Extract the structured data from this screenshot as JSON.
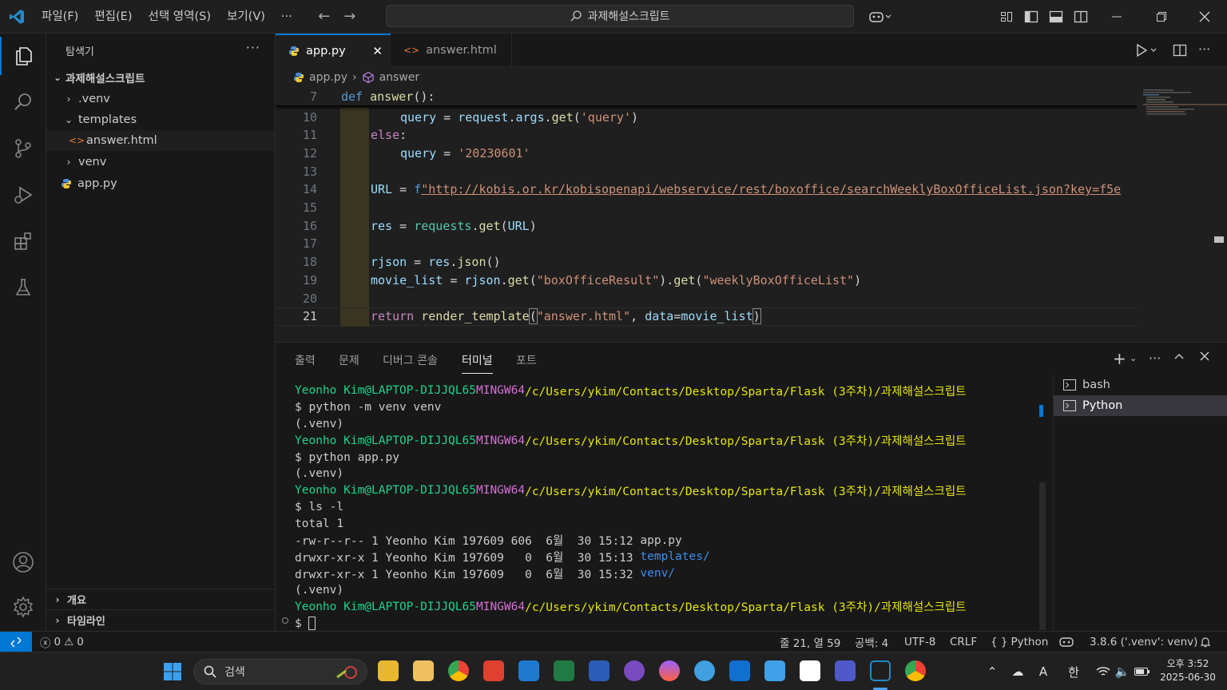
{
  "menu": [
    "파일(F)",
    "편집(E)",
    "선택 영역(S)",
    "보기(V)"
  ],
  "menu_more": "···",
  "command_center": "과제해설스크립트",
  "sidebar": {
    "title": "탐색기",
    "more": "···",
    "root": "과제해설스크립트",
    "items": [
      {
        "label": ".venv",
        "type": "folder-collapsed"
      },
      {
        "label": "templates",
        "type": "folder-expanded"
      },
      {
        "label": "answer.html",
        "type": "html-file"
      },
      {
        "label": "venv",
        "type": "folder-collapsed"
      },
      {
        "label": "app.py",
        "type": "python-file"
      }
    ],
    "outline": "개요",
    "timeline": "타임라인"
  },
  "tabs": [
    {
      "label": "app.py",
      "active": true
    },
    {
      "label": "answer.html",
      "active": false
    }
  ],
  "breadcrumb": {
    "file": "app.py",
    "symbol": "answer"
  },
  "editor": {
    "sticky": {
      "num": "7",
      "kw": "def",
      "fn": "answer",
      "rest": "():"
    },
    "lines": [
      {
        "num": "10",
        "indent": 2,
        "parts": [
          [
            "var",
            "query"
          ],
          [
            "pl",
            " = "
          ],
          [
            "var",
            "request"
          ],
          [
            "pl",
            "."
          ],
          [
            "var",
            "args"
          ],
          [
            "pl",
            "."
          ],
          [
            "fn",
            "get"
          ],
          [
            "pl",
            "("
          ],
          [
            "str",
            "'query'"
          ],
          [
            "pl",
            ")"
          ]
        ]
      },
      {
        "num": "11",
        "indent": 1,
        "parts": [
          [
            "ctl",
            "else"
          ],
          [
            "pl",
            ":"
          ]
        ]
      },
      {
        "num": "12",
        "indent": 2,
        "parts": [
          [
            "var",
            "query"
          ],
          [
            "pl",
            " = "
          ],
          [
            "str",
            "'20230601'"
          ]
        ]
      },
      {
        "num": "13",
        "indent": 0,
        "parts": []
      },
      {
        "num": "14",
        "indent": 1,
        "parts": [
          [
            "var",
            "URL"
          ],
          [
            "pl",
            " = "
          ],
          [
            "kw",
            "f"
          ],
          [
            "str",
            "\"http://kobis.or.kr/kobisopenapi/webservice/rest/boxoffice/searchWeeklyBoxOfficeList.json?key=f5e"
          ]
        ]
      },
      {
        "num": "15",
        "indent": 0,
        "parts": []
      },
      {
        "num": "16",
        "indent": 1,
        "parts": [
          [
            "var",
            "res"
          ],
          [
            "pl",
            " = "
          ],
          [
            "ty",
            "requests"
          ],
          [
            "pl",
            "."
          ],
          [
            "fn",
            "get"
          ],
          [
            "pl",
            "("
          ],
          [
            "var",
            "URL"
          ],
          [
            "pl",
            ")"
          ]
        ]
      },
      {
        "num": "17",
        "indent": 0,
        "parts": []
      },
      {
        "num": "18",
        "indent": 1,
        "parts": [
          [
            "var",
            "rjson"
          ],
          [
            "pl",
            " = "
          ],
          [
            "var",
            "res"
          ],
          [
            "pl",
            "."
          ],
          [
            "fn",
            "json"
          ],
          [
            "pl",
            "()"
          ]
        ]
      },
      {
        "num": "19",
        "indent": 1,
        "parts": [
          [
            "var",
            "movie_list"
          ],
          [
            "pl",
            " = "
          ],
          [
            "var",
            "rjson"
          ],
          [
            "pl",
            "."
          ],
          [
            "fn",
            "get"
          ],
          [
            "pl",
            "("
          ],
          [
            "str",
            "\"boxOfficeResult\""
          ],
          [
            "pl",
            ")."
          ],
          [
            "fn",
            "get"
          ],
          [
            "pl",
            "("
          ],
          [
            "str",
            "\"weeklyBoxOfficeList\""
          ],
          [
            "pl",
            ")"
          ]
        ]
      },
      {
        "num": "20",
        "indent": 0,
        "parts": []
      },
      {
        "num": "21",
        "indent": 1,
        "current": true,
        "parts": [
          [
            "ctl",
            "return"
          ],
          [
            "pl",
            " "
          ],
          [
            "fn",
            "render_template"
          ],
          [
            "pl",
            "("
          ],
          [
            "str",
            "\"answer.html\""
          ],
          [
            "pl",
            ", "
          ],
          [
            "var",
            "data"
          ],
          [
            "pl",
            "="
          ],
          [
            "var",
            "movie_list"
          ],
          [
            "pl",
            ")"
          ]
        ]
      }
    ]
  },
  "panel": {
    "tabs": [
      "출력",
      "문제",
      "디버그 콘솔",
      "터미널",
      "포트"
    ],
    "active_tab": "터미널",
    "terminals": [
      "bash",
      "Python"
    ],
    "selected_terminal": "Python",
    "terminal_lines": [
      {
        "type": "prompt",
        "user": "Yeonho Kim@LAPTOP-DIJJQL65",
        "sys": "MINGW64",
        "path": "/c/Users/ykim/Contacts/Desktop/Sparta/Flask (3주차)/과제해설스크립트"
      },
      {
        "type": "text",
        "text": "$ python -m venv venv"
      },
      {
        "type": "text",
        "text": "(.venv)"
      },
      {
        "type": "prompt",
        "user": "Yeonho Kim@LAPTOP-DIJJQL65",
        "sys": "MINGW64",
        "path": "/c/Users/ykim/Contacts/Desktop/Sparta/Flask (3주차)/과제해설스크립트"
      },
      {
        "type": "text",
        "text": "$ python app.py"
      },
      {
        "type": "text",
        "text": "(.venv)"
      },
      {
        "type": "prompt",
        "user": "Yeonho Kim@LAPTOP-DIJJQL65",
        "sys": "MINGW64",
        "path": "/c/Users/ykim/Contacts/Desktop/Sparta/Flask (3주차)/과제해설스크립트"
      },
      {
        "type": "text",
        "text": "$ ls -l"
      },
      {
        "type": "text",
        "text": "total 1"
      },
      {
        "type": "ls",
        "text": "-rw-r--r-- 1 Yeonho Kim 197609 606  6월  30 15:12 ",
        "name": "app.py",
        "dir": false
      },
      {
        "type": "ls",
        "text": "drwxr-xr-x 1 Yeonho Kim 197609   0  6월  30 15:13 ",
        "name": "templates/",
        "dir": true
      },
      {
        "type": "ls",
        "text": "drwxr-xr-x 1 Yeonho Kim 197609   0  6월  30 15:32 ",
        "name": "venv/",
        "dir": true
      },
      {
        "type": "text",
        "text": "(.venv)"
      },
      {
        "type": "prompt",
        "user": "Yeonho Kim@LAPTOP-DIJJQL65",
        "sys": "MINGW64",
        "path": "/c/Users/ykim/Contacts/Desktop/Sparta/Flask (3주차)/과제해설스크립트"
      },
      {
        "type": "cursor",
        "text": "$ "
      }
    ]
  },
  "status": {
    "errors": "0",
    "warnings": "0",
    "position": "줄 21, 열 59",
    "spaces": "공백: 4",
    "encoding": "UTF-8",
    "eol": "CRLF",
    "language": "Python",
    "interpreter": "3.8.6 ('.venv': venv)"
  },
  "taskbar": {
    "search": "검색",
    "time": "오후 3:52",
    "date": "2025-06-30",
    "ime": "한",
    "font_indicator": "A"
  },
  "colors": {
    "accent": "#0078d4",
    "editor_bg": "#1f1f1f",
    "sidebar_bg": "#181818"
  }
}
